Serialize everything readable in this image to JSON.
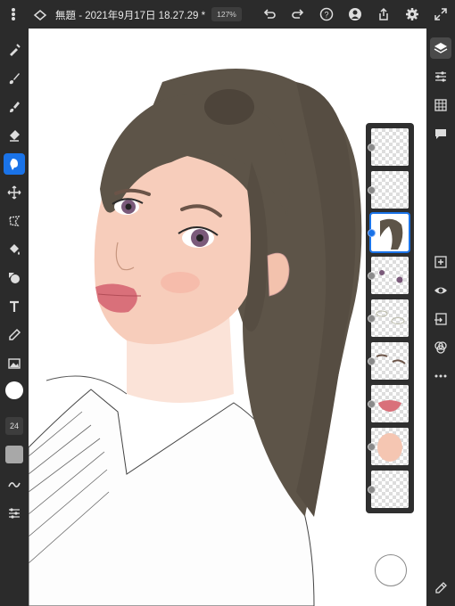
{
  "header": {
    "title": "無題 - 2021年9月17日 18.27.29 *",
    "zoom": "127%"
  },
  "left_tools": {
    "brush_size": "24",
    "icons": [
      "select-icon",
      "brush-icon",
      "blend-brush-icon",
      "eraser-icon",
      "smudge-icon",
      "move-icon",
      "lasso-icon",
      "fill-icon",
      "shape-icon",
      "text-icon",
      "eyedropper-icon",
      "image-icon"
    ],
    "color_white": "#ffffff",
    "color_gray": "#a8a8a8"
  },
  "right_tools": {
    "icons": [
      "layers-icon",
      "adjustments-icon",
      "grid-icon",
      "comment-icon",
      "add-layer-icon",
      "visibility-icon",
      "import-icon",
      "blend-mode-icon",
      "more-icon",
      "edit-icon"
    ]
  },
  "layers": [
    {
      "name": "layer-1",
      "selected": false
    },
    {
      "name": "layer-2",
      "selected": false
    },
    {
      "name": "layer-3-hair",
      "selected": true
    },
    {
      "name": "layer-4-eyes",
      "selected": false
    },
    {
      "name": "layer-5",
      "selected": false
    },
    {
      "name": "layer-6-brows",
      "selected": false
    },
    {
      "name": "layer-7-lips",
      "selected": false
    },
    {
      "name": "layer-8-skin",
      "selected": false
    },
    {
      "name": "layer-9",
      "selected": false
    }
  ],
  "colors": {
    "accent": "#1a73e8",
    "hair": "#5d5448",
    "skin": "#f5c6b2",
    "lips": "#d9707a"
  }
}
